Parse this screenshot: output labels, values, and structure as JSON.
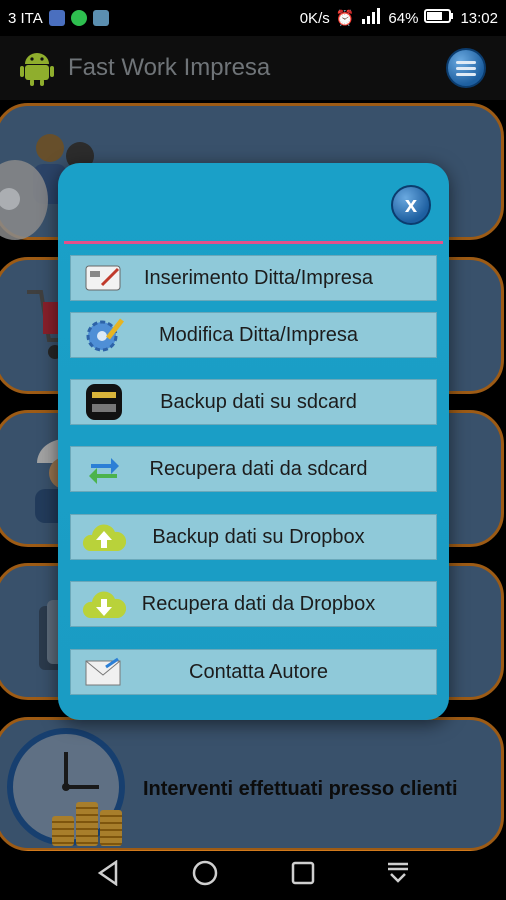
{
  "status_bar": {
    "carrier": "3 ITA",
    "speed": "0K/s",
    "battery": "64%",
    "time": "13:02"
  },
  "app_bar": {
    "title": "Fast Work Impresa"
  },
  "background": {
    "card5_label": "Interventi effettuati  presso clienti"
  },
  "dialog": {
    "close_label": "x",
    "items": [
      {
        "label": "Inserimento Ditta/Impresa",
        "icon": "form-edit-icon"
      },
      {
        "label": "Modifica  Ditta/Impresa",
        "icon": "gear-pencil-icon"
      },
      {
        "label": "Backup dati su sdcard",
        "icon": "sdcard-icon"
      },
      {
        "label": "Recupera dati da sdcard",
        "icon": "sync-arrows-icon"
      },
      {
        "label": "Backup dati su Dropbox",
        "icon": "cloud-upload-icon"
      },
      {
        "label": "Recupera dati da Dropbox",
        "icon": "cloud-download-icon"
      },
      {
        "label": "Contatta Autore",
        "icon": "envelope-icon"
      }
    ]
  },
  "colors": {
    "dialog_bg": "#1aa0c8",
    "item_bg": "#8fc9d9",
    "divider": "#e6508a",
    "card_bg": "#4c6d8f",
    "card_border": "#d27a1c"
  }
}
